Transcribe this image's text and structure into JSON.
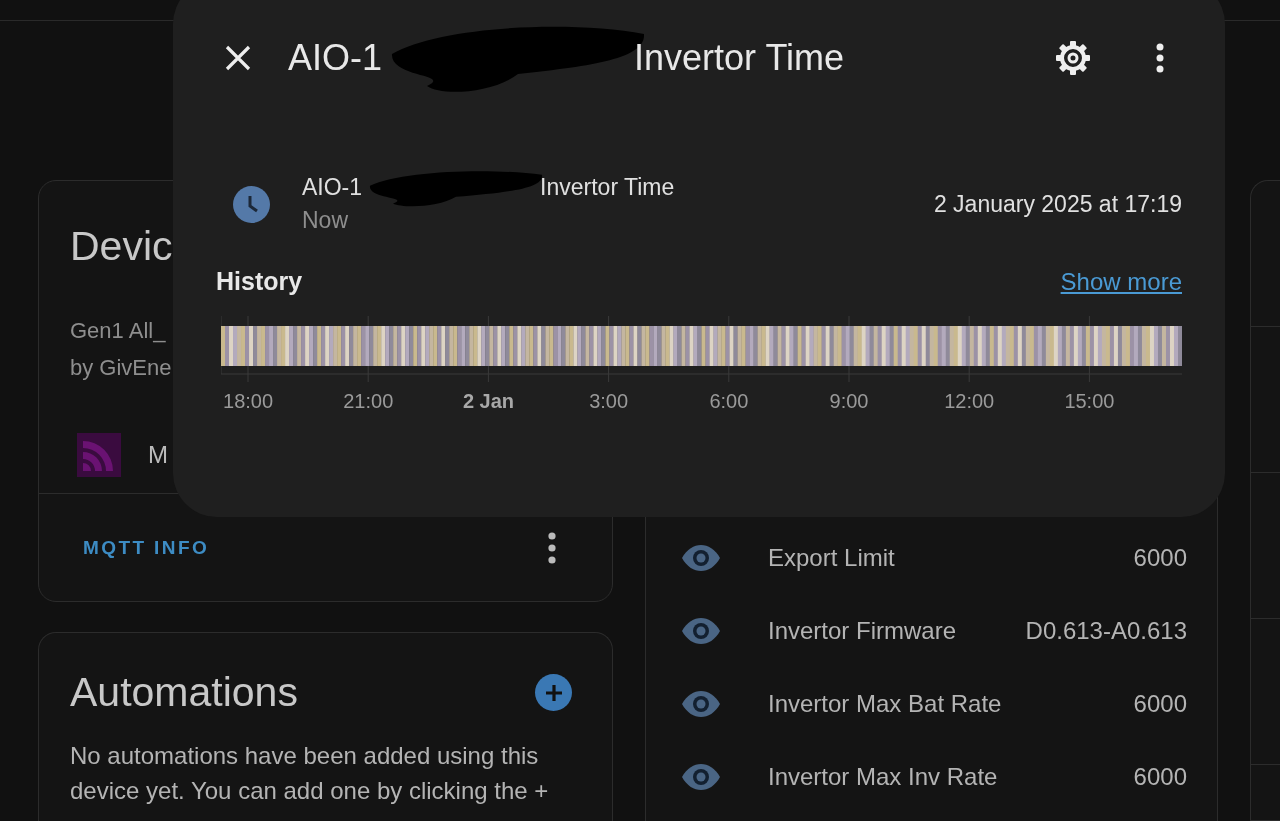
{
  "device_card": {
    "title": "Devic",
    "lines": [
      "Gen1 All_",
      "by GivEne"
    ],
    "integration": "M",
    "action": "MQTT INFO"
  },
  "automations_card": {
    "title": "Automations",
    "text": "No automations have been added using this device yet. You can add one by clicking the +"
  },
  "sensors": [
    {
      "name": "Export Limit",
      "value": "6000"
    },
    {
      "name": "Invertor Firmware",
      "value": "D0.613-A0.613"
    },
    {
      "name": "Invertor Max Bat Rate",
      "value": "6000"
    },
    {
      "name": "Invertor Max Inv Rate",
      "value": "6000"
    }
  ],
  "dialog": {
    "title_start": "AIO-1",
    "title_end": "Invertor Time",
    "entity": {
      "name_start": "AIO-1",
      "name_end": "Invertor Time",
      "time": "Now",
      "value": "2 January 2025 at 17:19"
    },
    "history": {
      "heading": "History",
      "link": "Show more",
      "axis_labels": [
        {
          "label": "18:00",
          "bold": false
        },
        {
          "label": "21:00",
          "bold": false
        },
        {
          "label": "2 Jan",
          "bold": true
        },
        {
          "label": "3:00",
          "bold": false
        },
        {
          "label": "6:00",
          "bold": false
        },
        {
          "label": "9:00",
          "bold": false
        },
        {
          "label": "12:00",
          "bold": false
        },
        {
          "label": "15:00",
          "bold": false
        }
      ]
    }
  }
}
